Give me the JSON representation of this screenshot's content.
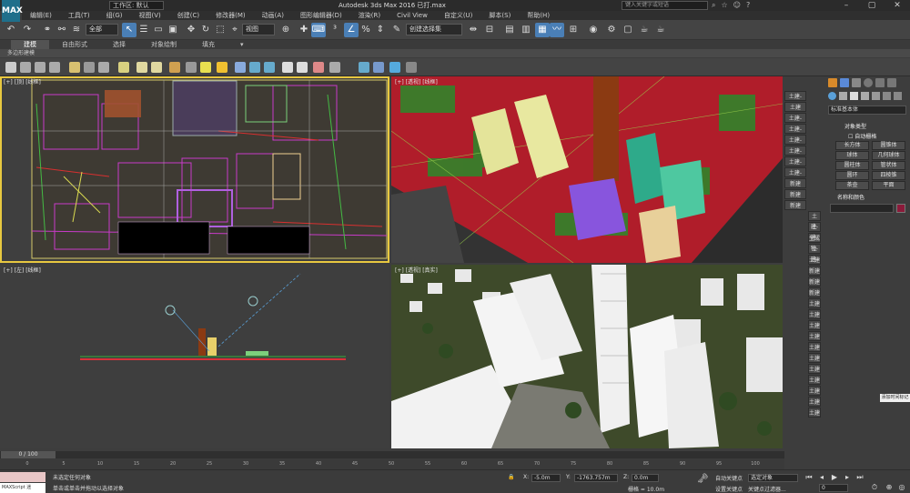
{
  "app": {
    "logo": "MAX",
    "window_title": "Autodesk 3ds Max 2016    已打.max",
    "search_placeholder": "键入关键字或短语",
    "workspace": "工作区: 默认"
  },
  "menu": [
    "编辑(E)",
    "工具(T)",
    "组(G)",
    "视图(V)",
    "创建(C)",
    "修改器(M)",
    "动画(A)",
    "图形编辑器(D)",
    "渲染(R)",
    "Civil View",
    "自定义(U)",
    "脚本(S)",
    "帮助(H)"
  ],
  "window_controls": [
    "–",
    "▢",
    "✕"
  ],
  "title_icons": [
    "binoculars-icon",
    "star-icon",
    "user-icon",
    "help-icon"
  ],
  "toolbar": {
    "selection_filter": "全部",
    "ref_coord": "视图",
    "named_sel": "创建选择集"
  },
  "ribbon": {
    "tabs": [
      "建模",
      "自由形式",
      "选择",
      "对象绘制",
      "填充"
    ],
    "active_tab": 0,
    "strip": "多边形建模"
  },
  "viewports": {
    "top_left": {
      "label": "[+] [顶] [线框]"
    },
    "top_right": {
      "label": "[+] [透视] [线框]"
    },
    "bottom_left": {
      "label": "[+] [左] [线框]"
    },
    "bottom_right": {
      "label": "[+] [透视] [真实]"
    }
  },
  "command_panel": {
    "side_labels": [
      "土建-",
      "土建",
      "土建-",
      "土建-",
      "土建-",
      "土建-",
      "土建-",
      "土建-",
      "新建",
      "新建",
      "新建",
      "土建-",
      "土建-",
      "生成物-",
      "土建-",
      "土建",
      "新建",
      "新建",
      "新建",
      "土建",
      "土建",
      "土建",
      "土建",
      "土建",
      "土建",
      "土建",
      "土建",
      "土建",
      "土建",
      "土建"
    ],
    "category": "标准基本体",
    "rollout_object_type": "对象类型",
    "autogrid": "自动栅格",
    "buttons": [
      "长方体",
      "圆锥体",
      "球体",
      "几何球体",
      "圆柱体",
      "管状体",
      "圆环",
      "四棱锥",
      "茶壶",
      "平面"
    ],
    "rollout_name_color": "名称和颜色",
    "name_color": "#8b1a3a"
  },
  "timeline": {
    "frame_display": "0 / 100",
    "ticks": [
      "0",
      "5",
      "10",
      "15",
      "20",
      "25",
      "30",
      "35",
      "40",
      "45",
      "50",
      "55",
      "60",
      "65",
      "70",
      "75",
      "80",
      "85",
      "90",
      "95",
      "100"
    ]
  },
  "status": {
    "maxscript_top": "",
    "maxscript_bottom": "MAXScript 迷",
    "selection_msg": "未选定任何对象",
    "prompt_msg": "单击或单击并拖动以选择对象",
    "x_label": "X:",
    "x_value": "-5.0m",
    "y_label": "Y:",
    "y_value": "-1763.757m",
    "z_label": "Z:",
    "z_value": "0.0m",
    "grid_label": "栅格 = 10.0m",
    "autokey": "自动关键点",
    "set_key": "设置关键点",
    "selected": "选定对象",
    "key_filters": "关键点过滤器...",
    "frame_value": "0",
    "tooltip": "添加时间标记"
  }
}
